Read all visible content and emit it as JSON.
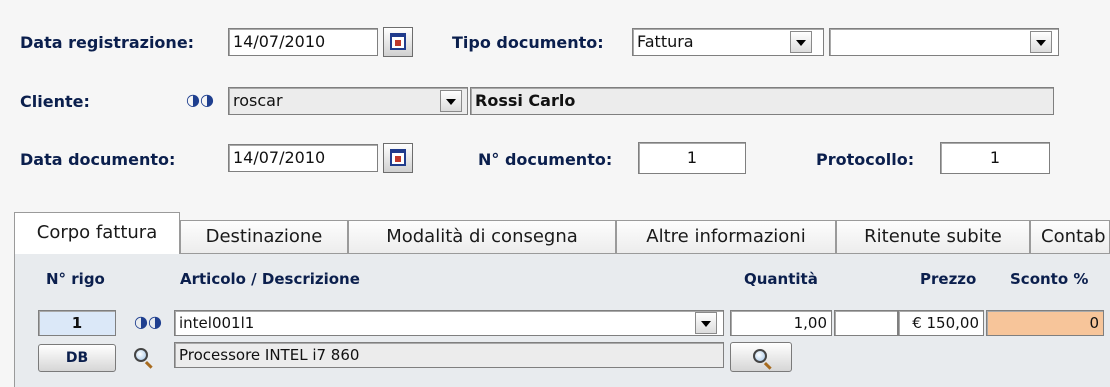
{
  "header": {
    "data_registrazione": {
      "label": "Data registrazione:",
      "value": "14/07/2010"
    },
    "tipo_documento": {
      "label": "Tipo documento:",
      "value": "Fattura",
      "value2": ""
    },
    "cliente": {
      "label": "Cliente:",
      "code": "roscar",
      "name": "Rossi Carlo"
    },
    "data_documento": {
      "label": "Data documento:",
      "value": "14/07/2010"
    },
    "n_documento": {
      "label": "N° documento:",
      "value": "1"
    },
    "protocollo": {
      "label": "Protocollo:",
      "value": "1"
    }
  },
  "tabs": [
    {
      "label": "Corpo fattura",
      "active": true
    },
    {
      "label": "Destinazione"
    },
    {
      "label": "Modalità di consegna"
    },
    {
      "label": "Altre informazioni"
    },
    {
      "label": "Ritenute subite"
    },
    {
      "label": "Contab"
    }
  ],
  "grid": {
    "columns": {
      "n_rigo": "N° rigo",
      "articolo": "Articolo / Descrizione",
      "quantita": "Quantità",
      "prezzo": "Prezzo",
      "sconto": "Sconto %"
    },
    "row": {
      "n_rigo": "1",
      "articolo": "intel001l1",
      "descrizione": "Processore INTEL i7 860",
      "quantita": "1,00",
      "quantita2": "",
      "prezzo": "€ 150,00",
      "sconto": "0"
    },
    "db_button": "DB"
  },
  "icons": {
    "binoculars": "binoculars-icon",
    "calendar": "calendar-icon",
    "magnifier": "magnifier-icon"
  }
}
